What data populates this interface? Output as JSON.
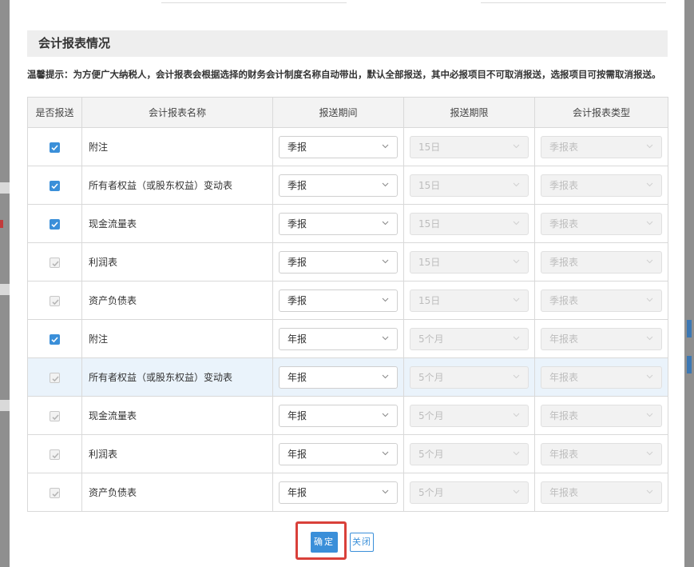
{
  "section": {
    "title": "会计报表情况",
    "tip": "温馨提示：为方便广大纳税人，会计报表会根据选择的财务会计制度名称自动带出，默认全部报送，其中必报项目不可取消报送，选报项目可按需取消报送。"
  },
  "table": {
    "headers": [
      "是否报送",
      "会计报表名称",
      "报送期间",
      "报送期限",
      "会计报表类型"
    ],
    "rows": [
      {
        "checked": true,
        "disabled": false,
        "name": "附注",
        "period": "季报",
        "deadline": "15日",
        "type": "季报表"
      },
      {
        "checked": true,
        "disabled": false,
        "name": "所有者权益（或股东权益）变动表",
        "period": "季报",
        "deadline": "15日",
        "type": "季报表"
      },
      {
        "checked": true,
        "disabled": false,
        "name": "现金流量表",
        "period": "季报",
        "deadline": "15日",
        "type": "季报表"
      },
      {
        "checked": true,
        "disabled": true,
        "name": "利润表",
        "period": "季报",
        "deadline": "15日",
        "type": "季报表"
      },
      {
        "checked": true,
        "disabled": true,
        "name": "资产负债表",
        "period": "季报",
        "deadline": "15日",
        "type": "季报表"
      },
      {
        "checked": true,
        "disabled": false,
        "name": "附注",
        "period": "年报",
        "deadline": "5个月",
        "type": "年报表"
      },
      {
        "checked": true,
        "disabled": true,
        "name": "所有者权益（或股东权益）变动表",
        "period": "年报",
        "deadline": "5个月",
        "type": "年报表",
        "highlighted": true
      },
      {
        "checked": true,
        "disabled": true,
        "name": "现金流量表",
        "period": "年报",
        "deadline": "5个月",
        "type": "年报表"
      },
      {
        "checked": true,
        "disabled": true,
        "name": "利润表",
        "period": "年报",
        "deadline": "5个月",
        "type": "年报表"
      },
      {
        "checked": true,
        "disabled": true,
        "name": "资产负债表",
        "period": "年报",
        "deadline": "5个月",
        "type": "年报表"
      }
    ]
  },
  "buttons": {
    "confirm": "确定",
    "close": "关闭"
  },
  "colors": {
    "accent": "#3a8fd9",
    "highlight_border": "#d9403a",
    "row_highlight": "#eaf3fb"
  }
}
